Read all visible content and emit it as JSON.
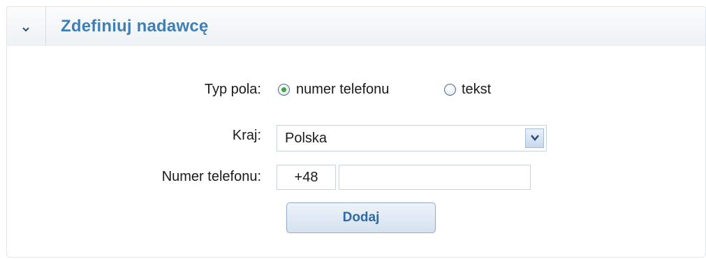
{
  "header": {
    "title": "Zdefiniuj nadawcę",
    "toggle_icon": "chevron-down-icon"
  },
  "form": {
    "field_type": {
      "label": "Typ pola:",
      "options": [
        {
          "label": "numer telefonu",
          "selected": true
        },
        {
          "label": "tekst",
          "selected": false
        }
      ]
    },
    "country": {
      "label": "Kraj:",
      "value": "Polska"
    },
    "phone": {
      "label": "Numer telefonu:",
      "prefix": "+48",
      "value": ""
    },
    "submit_label": "Dodaj"
  },
  "colors": {
    "title": "#3f7fb6",
    "radio_selected": "#3da83a",
    "button_text": "#2f6aa5"
  }
}
